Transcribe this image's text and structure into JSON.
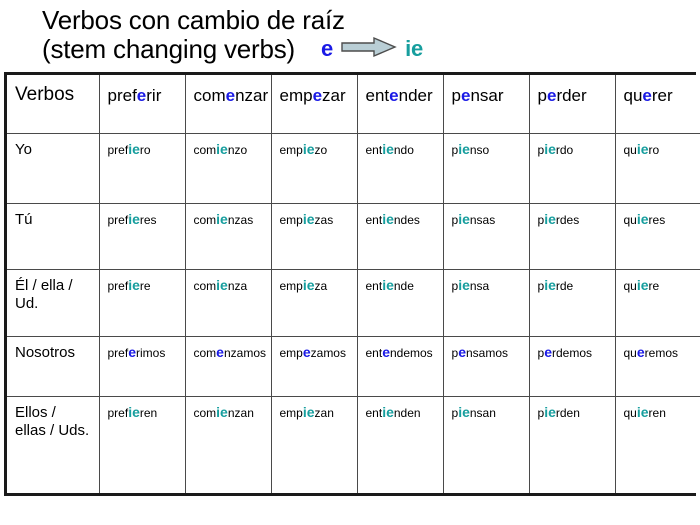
{
  "title": {
    "line1": "Verbos con cambio de raíz",
    "line2": "(stem changing verbs)",
    "rule_from": "e",
    "rule_to": "ie",
    "arrow_icon": "right-block-arrow-icon"
  },
  "colors": {
    "stem_source": "#1a1ae6",
    "stem_result": "#179e9e",
    "arrow_fill": "#b9ced5",
    "arrow_stroke": "#4d4d4d",
    "table_border": "#1a1a1a",
    "cell_border": "#4a4a4a"
  },
  "table": {
    "header": {
      "pronoun_label": "Verbos",
      "verbs": [
        {
          "full": "preferir",
          "pre": "pref",
          "stem": "e",
          "post": "rir"
        },
        {
          "full": "comenzar",
          "pre": "com",
          "stem": "e",
          "post": "nzar"
        },
        {
          "full": "empezar",
          "pre": "emp",
          "stem": "e",
          "post": "zar"
        },
        {
          "full": "entender",
          "pre": "ent",
          "stem": "e",
          "post": "nder"
        },
        {
          "full": "pensar",
          "pre": "p",
          "stem": "e",
          "post": "nsar"
        },
        {
          "full": "perder",
          "pre": "p",
          "stem": "e",
          "post": "rder"
        },
        {
          "full": "querer",
          "pre": "qu",
          "stem": "e",
          "post": "rer"
        }
      ]
    },
    "rows": [
      {
        "pronoun": "Yo",
        "stem_changes": true,
        "forms": [
          {
            "full": "prefiero",
            "pre": "pref",
            "stem": "ie",
            "post": "ro"
          },
          {
            "full": "comienzo",
            "pre": "com",
            "stem": "ie",
            "post": "nzo"
          },
          {
            "full": "empiezo",
            "pre": "emp",
            "stem": "ie",
            "post": "zo"
          },
          {
            "full": "entiendo",
            "pre": "ent",
            "stem": "ie",
            "post": "ndo"
          },
          {
            "full": "pienso",
            "pre": "p",
            "stem": "ie",
            "post": "nso"
          },
          {
            "full": "pierdo",
            "pre": "p",
            "stem": "ie",
            "post": "rdo"
          },
          {
            "full": "quiero",
            "pre": "qu",
            "stem": "ie",
            "post": "ro"
          }
        ]
      },
      {
        "pronoun": "Tú",
        "stem_changes": true,
        "forms": [
          {
            "full": "prefieres",
            "pre": "pref",
            "stem": "ie",
            "post": "res"
          },
          {
            "full": "comienzas",
            "pre": "com",
            "stem": "ie",
            "post": "nzas"
          },
          {
            "full": "empiezas",
            "pre": "emp",
            "stem": "ie",
            "post": "zas"
          },
          {
            "full": "entiendes",
            "pre": "ent",
            "stem": "ie",
            "post": "ndes"
          },
          {
            "full": "piensas",
            "pre": "p",
            "stem": "ie",
            "post": "nsas"
          },
          {
            "full": "pierdes",
            "pre": "p",
            "stem": "ie",
            "post": "rdes"
          },
          {
            "full": "quieres",
            "pre": "qu",
            "stem": "ie",
            "post": "res"
          }
        ]
      },
      {
        "pronoun": "Él / ella / Ud.",
        "stem_changes": true,
        "forms": [
          {
            "full": "prefiere",
            "pre": "pref",
            "stem": "ie",
            "post": "re"
          },
          {
            "full": "comienza",
            "pre": "com",
            "stem": "ie",
            "post": "nza"
          },
          {
            "full": "empieza",
            "pre": "emp",
            "stem": "ie",
            "post": "za"
          },
          {
            "full": "entiende",
            "pre": "ent",
            "stem": "ie",
            "post": "nde"
          },
          {
            "full": "piensa",
            "pre": "p",
            "stem": "ie",
            "post": "nsa"
          },
          {
            "full": "pierde",
            "pre": "p",
            "stem": "ie",
            "post": "rde"
          },
          {
            "full": "quiere",
            "pre": "qu",
            "stem": "ie",
            "post": "re"
          }
        ]
      },
      {
        "pronoun": "Nosotros",
        "stem_changes": false,
        "forms": [
          {
            "full": "preferimos",
            "pre": "pref",
            "stem": "e",
            "post": "rimos"
          },
          {
            "full": "comenzamos",
            "pre": "com",
            "stem": "e",
            "post": "nzamos"
          },
          {
            "full": "empezamos",
            "pre": "emp",
            "stem": "e",
            "post": "zamos"
          },
          {
            "full": "entendemos",
            "pre": "ent",
            "stem": "e",
            "post": "ndemos"
          },
          {
            "full": "pensamos",
            "pre": "p",
            "stem": "e",
            "post": "nsamos"
          },
          {
            "full": "perdemos",
            "pre": "p",
            "stem": "e",
            "post": "rdemos"
          },
          {
            "full": "queremos",
            "pre": "qu",
            "stem": "e",
            "post": "remos"
          }
        ]
      },
      {
        "pronoun": "Ellos / ellas / Uds.",
        "stem_changes": true,
        "forms": [
          {
            "full": "prefieren",
            "pre": "pref",
            "stem": "ie",
            "post": "ren"
          },
          {
            "full": "comienzan",
            "pre": "com",
            "stem": "ie",
            "post": "nzan"
          },
          {
            "full": "empiezan",
            "pre": "emp",
            "stem": "ie",
            "post": "zan"
          },
          {
            "full": "entienden",
            "pre": "ent",
            "stem": "ie",
            "post": "nden"
          },
          {
            "full": "piensan",
            "pre": "p",
            "stem": "ie",
            "post": "nsan"
          },
          {
            "full": "pierden",
            "pre": "p",
            "stem": "ie",
            "post": "rden"
          },
          {
            "full": "quieren",
            "pre": "qu",
            "stem": "ie",
            "post": "ren"
          }
        ]
      }
    ]
  }
}
